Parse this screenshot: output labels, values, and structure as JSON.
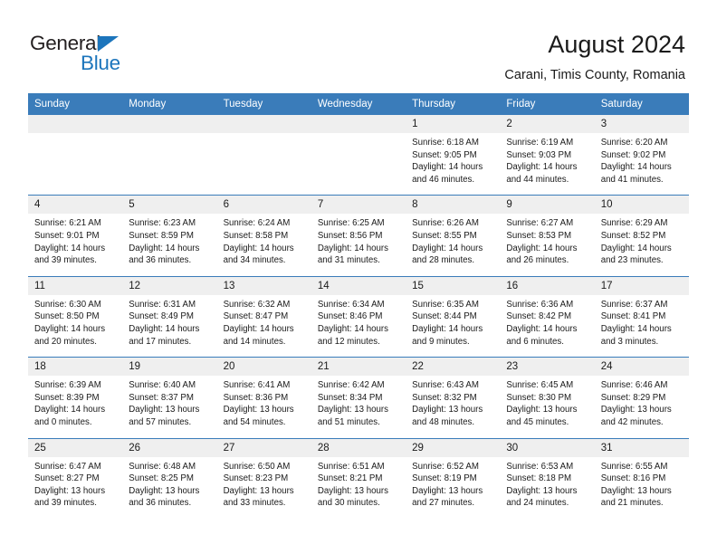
{
  "brand": {
    "name_top": "General",
    "name_bottom": "Blue",
    "triangle_color": "#1c75bc",
    "text_color": "#231f20"
  },
  "header": {
    "title": "August 2024",
    "subtitle": "Carani, Timis County, Romania"
  },
  "theme": {
    "header_bg": "#3a7cba",
    "header_text": "#ffffff",
    "daynum_bg": "#efefef",
    "cell_bg": "#ffffff",
    "row_divider": "#3a7cba",
    "body_text": "#1a1a1a"
  },
  "weekdays": [
    "Sunday",
    "Monday",
    "Tuesday",
    "Wednesday",
    "Thursday",
    "Friday",
    "Saturday"
  ],
  "labels": {
    "sunrise_prefix": "Sunrise:",
    "sunset_prefix": "Sunset:",
    "daylight_prefix": "Daylight:"
  },
  "weeks": [
    [
      {
        "day": "",
        "empty": true,
        "line1": "",
        "line2": "",
        "line3": "",
        "line4": ""
      },
      {
        "day": "",
        "empty": true,
        "line1": "",
        "line2": "",
        "line3": "",
        "line4": ""
      },
      {
        "day": "",
        "empty": true,
        "line1": "",
        "line2": "",
        "line3": "",
        "line4": ""
      },
      {
        "day": "",
        "empty": true,
        "line1": "",
        "line2": "",
        "line3": "",
        "line4": ""
      },
      {
        "day": "1",
        "empty": false,
        "line1": "Sunrise: 6:18 AM",
        "line2": "Sunset: 9:05 PM",
        "line3": "Daylight: 14 hours",
        "line4": "and 46 minutes."
      },
      {
        "day": "2",
        "empty": false,
        "line1": "Sunrise: 6:19 AM",
        "line2": "Sunset: 9:03 PM",
        "line3": "Daylight: 14 hours",
        "line4": "and 44 minutes."
      },
      {
        "day": "3",
        "empty": false,
        "line1": "Sunrise: 6:20 AM",
        "line2": "Sunset: 9:02 PM",
        "line3": "Daylight: 14 hours",
        "line4": "and 41 minutes."
      }
    ],
    [
      {
        "day": "4",
        "empty": false,
        "line1": "Sunrise: 6:21 AM",
        "line2": "Sunset: 9:01 PM",
        "line3": "Daylight: 14 hours",
        "line4": "and 39 minutes."
      },
      {
        "day": "5",
        "empty": false,
        "line1": "Sunrise: 6:23 AM",
        "line2": "Sunset: 8:59 PM",
        "line3": "Daylight: 14 hours",
        "line4": "and 36 minutes."
      },
      {
        "day": "6",
        "empty": false,
        "line1": "Sunrise: 6:24 AM",
        "line2": "Sunset: 8:58 PM",
        "line3": "Daylight: 14 hours",
        "line4": "and 34 minutes."
      },
      {
        "day": "7",
        "empty": false,
        "line1": "Sunrise: 6:25 AM",
        "line2": "Sunset: 8:56 PM",
        "line3": "Daylight: 14 hours",
        "line4": "and 31 minutes."
      },
      {
        "day": "8",
        "empty": false,
        "line1": "Sunrise: 6:26 AM",
        "line2": "Sunset: 8:55 PM",
        "line3": "Daylight: 14 hours",
        "line4": "and 28 minutes."
      },
      {
        "day": "9",
        "empty": false,
        "line1": "Sunrise: 6:27 AM",
        "line2": "Sunset: 8:53 PM",
        "line3": "Daylight: 14 hours",
        "line4": "and 26 minutes."
      },
      {
        "day": "10",
        "empty": false,
        "line1": "Sunrise: 6:29 AM",
        "line2": "Sunset: 8:52 PM",
        "line3": "Daylight: 14 hours",
        "line4": "and 23 minutes."
      }
    ],
    [
      {
        "day": "11",
        "empty": false,
        "line1": "Sunrise: 6:30 AM",
        "line2": "Sunset: 8:50 PM",
        "line3": "Daylight: 14 hours",
        "line4": "and 20 minutes."
      },
      {
        "day": "12",
        "empty": false,
        "line1": "Sunrise: 6:31 AM",
        "line2": "Sunset: 8:49 PM",
        "line3": "Daylight: 14 hours",
        "line4": "and 17 minutes."
      },
      {
        "day": "13",
        "empty": false,
        "line1": "Sunrise: 6:32 AM",
        "line2": "Sunset: 8:47 PM",
        "line3": "Daylight: 14 hours",
        "line4": "and 14 minutes."
      },
      {
        "day": "14",
        "empty": false,
        "line1": "Sunrise: 6:34 AM",
        "line2": "Sunset: 8:46 PM",
        "line3": "Daylight: 14 hours",
        "line4": "and 12 minutes."
      },
      {
        "day": "15",
        "empty": false,
        "line1": "Sunrise: 6:35 AM",
        "line2": "Sunset: 8:44 PM",
        "line3": "Daylight: 14 hours",
        "line4": "and 9 minutes."
      },
      {
        "day": "16",
        "empty": false,
        "line1": "Sunrise: 6:36 AM",
        "line2": "Sunset: 8:42 PM",
        "line3": "Daylight: 14 hours",
        "line4": "and 6 minutes."
      },
      {
        "day": "17",
        "empty": false,
        "line1": "Sunrise: 6:37 AM",
        "line2": "Sunset: 8:41 PM",
        "line3": "Daylight: 14 hours",
        "line4": "and 3 minutes."
      }
    ],
    [
      {
        "day": "18",
        "empty": false,
        "line1": "Sunrise: 6:39 AM",
        "line2": "Sunset: 8:39 PM",
        "line3": "Daylight: 14 hours",
        "line4": "and 0 minutes."
      },
      {
        "day": "19",
        "empty": false,
        "line1": "Sunrise: 6:40 AM",
        "line2": "Sunset: 8:37 PM",
        "line3": "Daylight: 13 hours",
        "line4": "and 57 minutes."
      },
      {
        "day": "20",
        "empty": false,
        "line1": "Sunrise: 6:41 AM",
        "line2": "Sunset: 8:36 PM",
        "line3": "Daylight: 13 hours",
        "line4": "and 54 minutes."
      },
      {
        "day": "21",
        "empty": false,
        "line1": "Sunrise: 6:42 AM",
        "line2": "Sunset: 8:34 PM",
        "line3": "Daylight: 13 hours",
        "line4": "and 51 minutes."
      },
      {
        "day": "22",
        "empty": false,
        "line1": "Sunrise: 6:43 AM",
        "line2": "Sunset: 8:32 PM",
        "line3": "Daylight: 13 hours",
        "line4": "and 48 minutes."
      },
      {
        "day": "23",
        "empty": false,
        "line1": "Sunrise: 6:45 AM",
        "line2": "Sunset: 8:30 PM",
        "line3": "Daylight: 13 hours",
        "line4": "and 45 minutes."
      },
      {
        "day": "24",
        "empty": false,
        "line1": "Sunrise: 6:46 AM",
        "line2": "Sunset: 8:29 PM",
        "line3": "Daylight: 13 hours",
        "line4": "and 42 minutes."
      }
    ],
    [
      {
        "day": "25",
        "empty": false,
        "line1": "Sunrise: 6:47 AM",
        "line2": "Sunset: 8:27 PM",
        "line3": "Daylight: 13 hours",
        "line4": "and 39 minutes."
      },
      {
        "day": "26",
        "empty": false,
        "line1": "Sunrise: 6:48 AM",
        "line2": "Sunset: 8:25 PM",
        "line3": "Daylight: 13 hours",
        "line4": "and 36 minutes."
      },
      {
        "day": "27",
        "empty": false,
        "line1": "Sunrise: 6:50 AM",
        "line2": "Sunset: 8:23 PM",
        "line3": "Daylight: 13 hours",
        "line4": "and 33 minutes."
      },
      {
        "day": "28",
        "empty": false,
        "line1": "Sunrise: 6:51 AM",
        "line2": "Sunset: 8:21 PM",
        "line3": "Daylight: 13 hours",
        "line4": "and 30 minutes."
      },
      {
        "day": "29",
        "empty": false,
        "line1": "Sunrise: 6:52 AM",
        "line2": "Sunset: 8:19 PM",
        "line3": "Daylight: 13 hours",
        "line4": "and 27 minutes."
      },
      {
        "day": "30",
        "empty": false,
        "line1": "Sunrise: 6:53 AM",
        "line2": "Sunset: 8:18 PM",
        "line3": "Daylight: 13 hours",
        "line4": "and 24 minutes."
      },
      {
        "day": "31",
        "empty": false,
        "line1": "Sunrise: 6:55 AM",
        "line2": "Sunset: 8:16 PM",
        "line3": "Daylight: 13 hours",
        "line4": "and 21 minutes."
      }
    ]
  ]
}
